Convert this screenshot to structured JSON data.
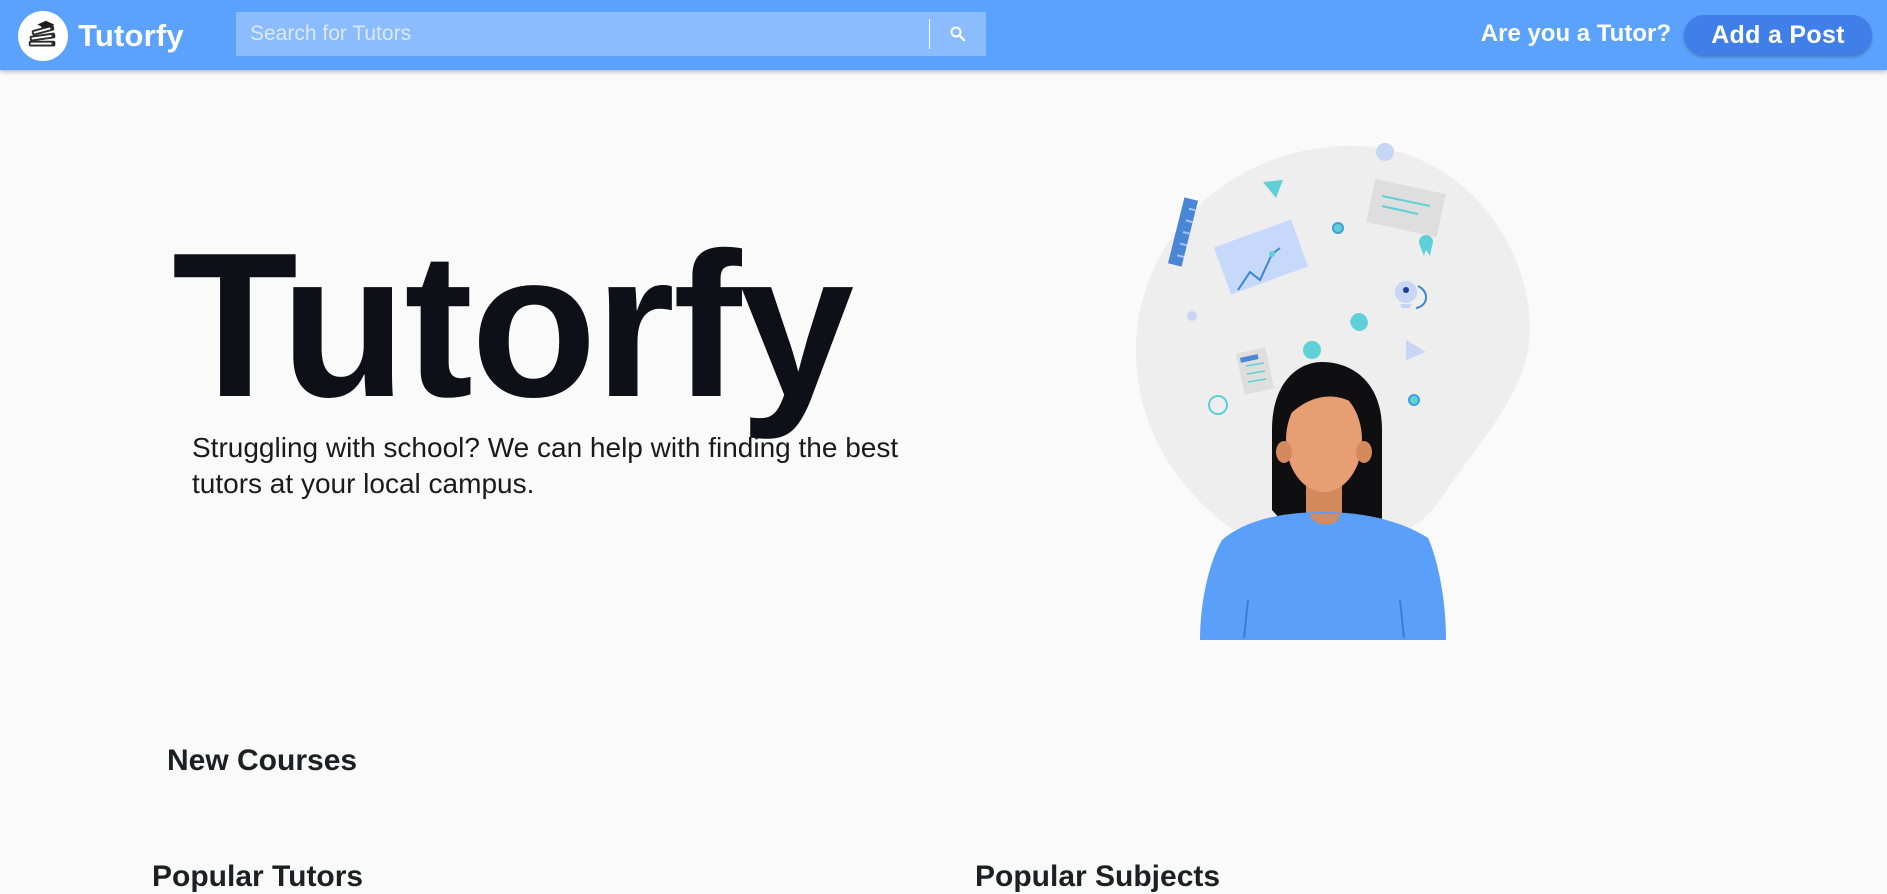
{
  "header": {
    "brand_name": "Tutorfy",
    "search_placeholder": "Search for Tutors",
    "tutor_prompt": "Are you a Tutor?",
    "add_post_label": "Add a Post"
  },
  "hero": {
    "title": "Tutorfy",
    "tagline": "Struggling with school? We can help with finding the best tutors at your local campus."
  },
  "sections": {
    "new_courses": "New Courses",
    "popular_tutors": "Popular Tutors",
    "popular_subjects": "Popular Subjects"
  },
  "colors": {
    "navbar": "#5ba2fe",
    "accent_button": "#3f7fe7",
    "page_background": "#fafafa"
  },
  "icons": [
    "books-logo-icon",
    "search-icon",
    "student-illustration"
  ]
}
